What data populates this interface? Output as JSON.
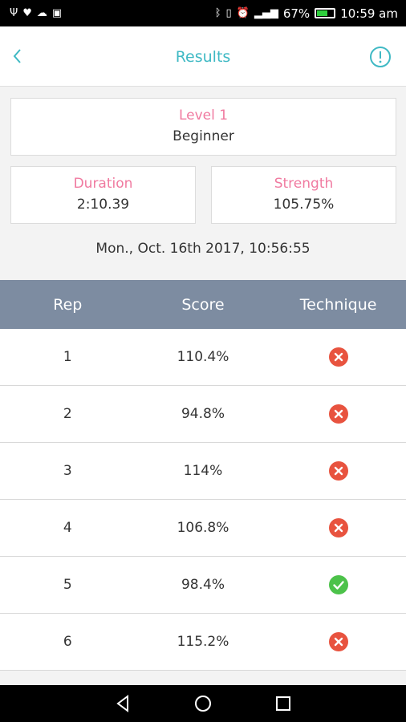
{
  "status_bar": {
    "time": "10:59 am",
    "battery_percent": "67%",
    "battery_level": 0.67,
    "left_icons": [
      "usb-icon",
      "heart-icon",
      "cloud-icon",
      "photo-icon"
    ],
    "right_icons": [
      "bluetooth-icon",
      "vibrate-icon",
      "alarm-icon",
      "signal-icon"
    ]
  },
  "header": {
    "title": "Results"
  },
  "level_card": {
    "label": "Level 1",
    "value": "Beginner"
  },
  "duration_card": {
    "label": "Duration",
    "value": "2:10.39"
  },
  "strength_card": {
    "label": "Strength",
    "value": "105.75%"
  },
  "date": "Mon., Oct. 16th 2017, 10:56:55",
  "table": {
    "columns": [
      "Rep",
      "Score",
      "Technique"
    ],
    "rows": [
      {
        "rep": "1",
        "score": "110.4%",
        "technique": "fail"
      },
      {
        "rep": "2",
        "score": "94.8%",
        "technique": "fail"
      },
      {
        "rep": "3",
        "score": "114%",
        "technique": "fail"
      },
      {
        "rep": "4",
        "score": "106.8%",
        "technique": "fail"
      },
      {
        "rep": "5",
        "score": "98.4%",
        "technique": "pass"
      },
      {
        "rep": "6",
        "score": "115.2%",
        "technique": "fail"
      }
    ]
  },
  "colors": {
    "accent": "#3fb9c4",
    "label_pink": "#f07aa0",
    "table_header": "#7d8ca1",
    "fail": "#e8533f",
    "pass": "#4cc24a"
  }
}
